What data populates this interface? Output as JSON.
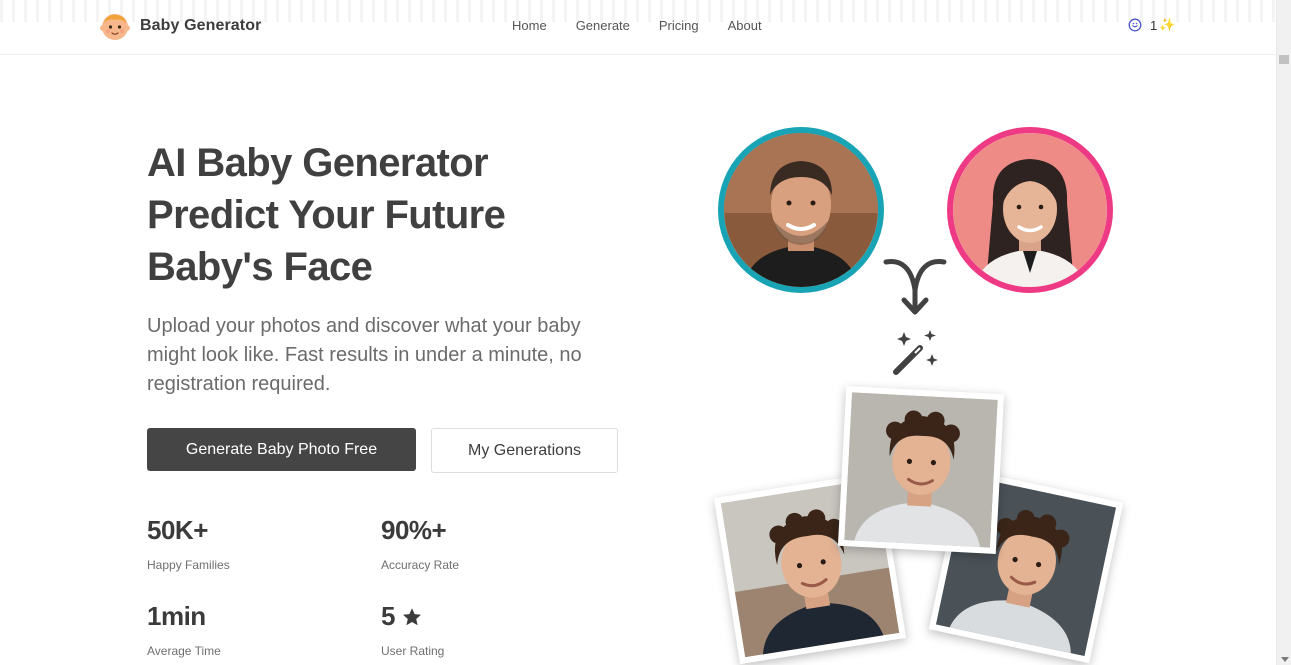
{
  "header": {
    "brand": "Baby Generator",
    "nav": [
      "Home",
      "Generate",
      "Pricing",
      "About"
    ],
    "credits": "1",
    "credits_emoji": "✨"
  },
  "hero": {
    "title_lines": [
      "AI Baby Generator",
      "Predict Your Future",
      "Baby's Face"
    ],
    "description": "Upload your photos and discover what your baby might look like. Fast results in under a minute, no registration required.",
    "primary_button": "Generate Baby Photo Free",
    "secondary_button": "My Generations"
  },
  "stats": [
    {
      "value": "50K+",
      "label": "Happy Families"
    },
    {
      "value": "90%+",
      "label": "Accuracy Rate"
    },
    {
      "value": "1min",
      "label": "Average Time"
    },
    {
      "value": "5",
      "label": "User Rating"
    }
  ],
  "colors": {
    "dad_ring": "#18a4b4",
    "mom_ring": "#ee3a84",
    "primary_button": "#454545",
    "text_dark": "#404040"
  },
  "icons": {
    "logo": "baby-face-icon",
    "credits": "coin-icon",
    "rating": "star-icon",
    "merge": "merge-arrow-icon",
    "magic": "magic-wand-icon"
  }
}
